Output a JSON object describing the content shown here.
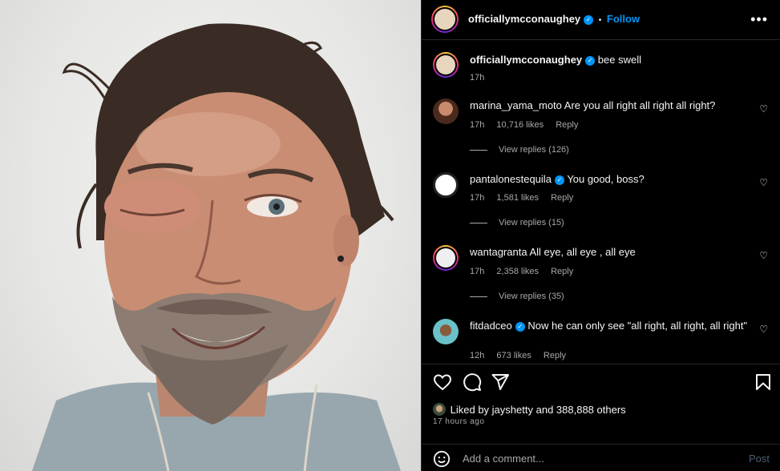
{
  "post": {
    "author": "officiallymcconaughey",
    "follow_sep": "•",
    "follow_label": "Follow",
    "more_icon": "more-icon",
    "image_alt": "Selfie of a smiling man with a swollen eye"
  },
  "comments": [
    {
      "user": "officiallymcconaughey",
      "verified": true,
      "text": "bee swell",
      "time": "17h"
    },
    {
      "user": "marina_yama_moto",
      "verified": false,
      "text": "Are you all right all right all right?",
      "time": "17h",
      "likes": "10,716 likes",
      "reply": "Reply",
      "view_replies": "View replies (126)"
    },
    {
      "user": "pantalonestequila",
      "verified": true,
      "text": "You good, boss?",
      "time": "17h",
      "likes": "1,581 likes",
      "reply": "Reply",
      "view_replies": "View replies (15)"
    },
    {
      "user": "wantagranta",
      "verified": false,
      "text": "All eye, all eye , all eye",
      "time": "17h",
      "likes": "2,358 likes",
      "reply": "Reply",
      "view_replies": "View replies (35)"
    },
    {
      "user": "fitdadceo",
      "verified": true,
      "text": "Now he can only see \"all right, all right, all right\"",
      "time": "12h",
      "likes": "673 likes",
      "reply": "Reply"
    }
  ],
  "actions": {
    "like_icon": "heart-icon",
    "comment_icon": "comment-icon",
    "share_icon": "share-icon",
    "save_icon": "bookmark-icon"
  },
  "likes": {
    "prefix": "Liked by",
    "user": "jayshetty",
    "suffix": "and 388,888 others"
  },
  "posted_ago": "17 hours ago",
  "add_comment": {
    "placeholder": "Add a comment...",
    "post_label": "Post"
  },
  "colors": {
    "accent": "#0095f6",
    "background": "#000000",
    "secondary_text": "#a8a8a8"
  }
}
